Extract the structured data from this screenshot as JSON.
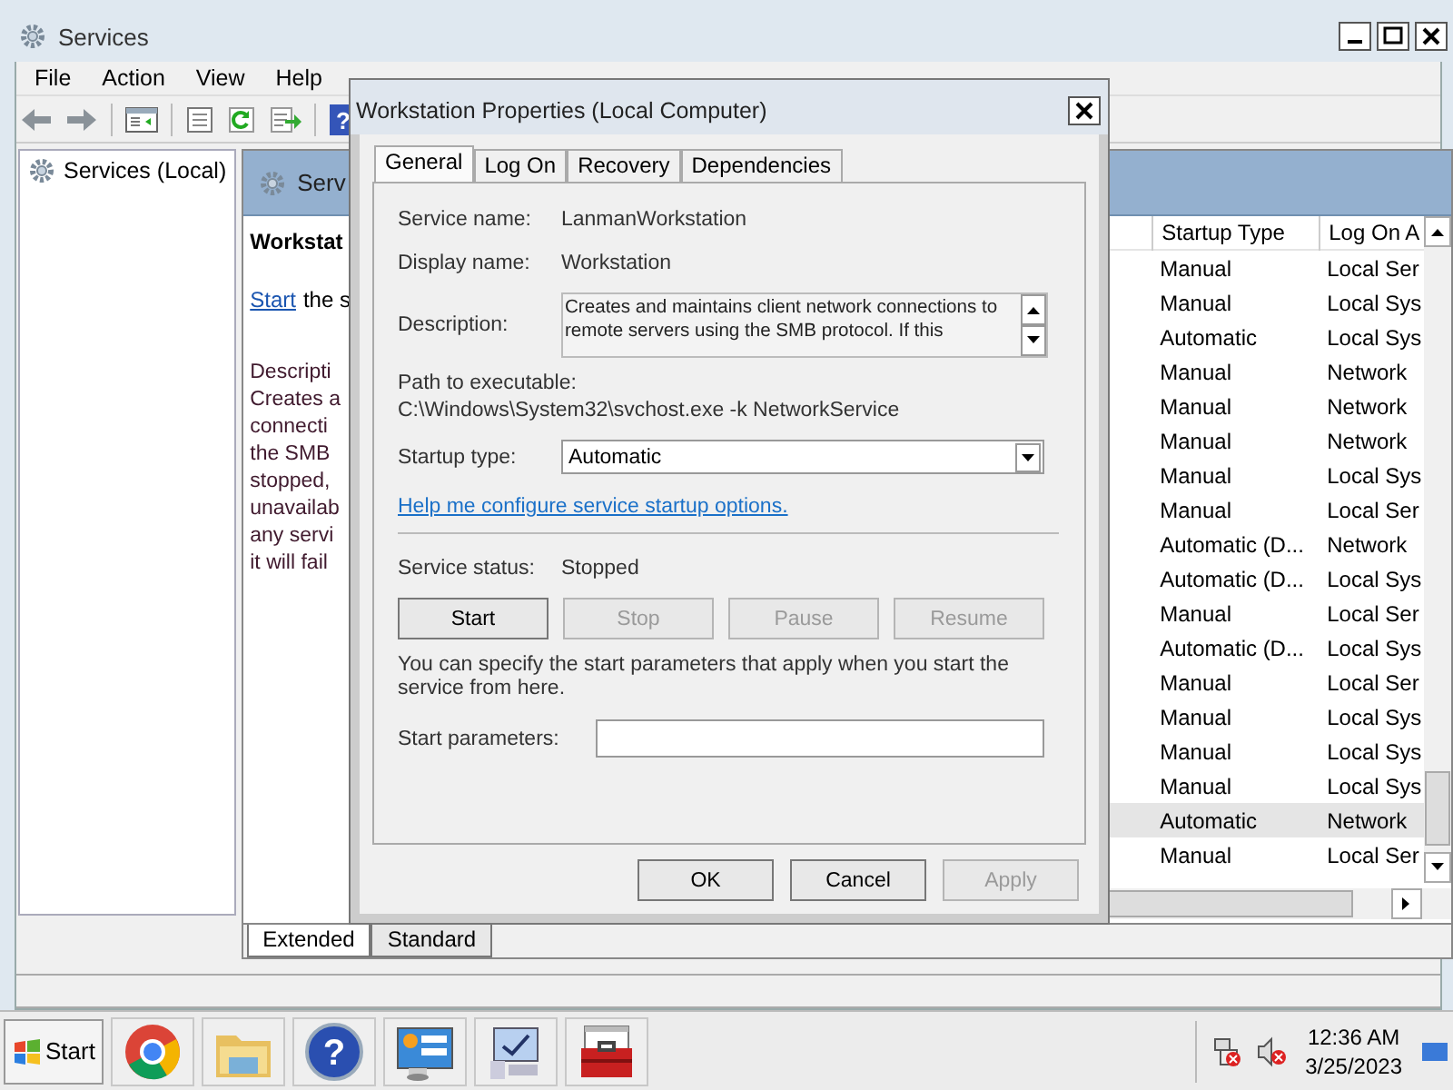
{
  "window": {
    "title": "Services"
  },
  "menu": [
    "File",
    "Action",
    "View",
    "Help"
  ],
  "toolbar": {
    "help_glyph": "?"
  },
  "tree": [
    {
      "label": "Services (Local)",
      "selected": false
    }
  ],
  "detail": {
    "header": "Serv",
    "heading": "Workstat",
    "start_link": "Start",
    "start_rest": "the s",
    "description_lines": [
      "Descripti",
      "Creates a",
      "connecti",
      "the SMB",
      "stopped,",
      "unavailab",
      "any servi",
      "it will fail"
    ]
  },
  "list": {
    "columns": [
      "Startup Type",
      "Log On A"
    ],
    "rows": [
      {
        "startup": "Manual",
        "logon": "Local Ser",
        "selected": false
      },
      {
        "startup": "Manual",
        "logon": "Local Sys",
        "selected": false
      },
      {
        "startup": "Automatic",
        "logon": "Local Sys",
        "selected": false
      },
      {
        "startup": "Manual",
        "logon": "Network",
        "selected": false
      },
      {
        "startup": "Manual",
        "logon": "Network",
        "selected": false
      },
      {
        "startup": "Manual",
        "logon": "Network",
        "selected": false
      },
      {
        "startup": "Manual",
        "logon": "Local Sys",
        "selected": false
      },
      {
        "startup": "Manual",
        "logon": "Local Ser",
        "selected": false
      },
      {
        "startup": "Automatic (D...",
        "logon": "Network",
        "selected": false
      },
      {
        "startup": "Automatic (D...",
        "logon": "Local Sys",
        "selected": false
      },
      {
        "startup": "Manual",
        "logon": "Local Ser",
        "selected": false
      },
      {
        "startup": "Automatic (D...",
        "logon": "Local Sys",
        "selected": false
      },
      {
        "startup": "Manual",
        "logon": "Local Ser",
        "selected": false
      },
      {
        "startup": "Manual",
        "logon": "Local Sys",
        "selected": false
      },
      {
        "startup": "Manual",
        "logon": "Local Sys",
        "selected": false
      },
      {
        "startup": "Manual",
        "logon": "Local Sys",
        "selected": false
      },
      {
        "startup": "Automatic",
        "logon": "Network",
        "selected": true
      },
      {
        "startup": "Manual",
        "logon": "Local Ser",
        "selected": false
      }
    ]
  },
  "view_tabs": [
    {
      "label": "Extended",
      "selected": true
    },
    {
      "label": "Standard",
      "selected": false
    }
  ],
  "dialog": {
    "title": "Workstation Properties (Local Computer)",
    "tabs": [
      {
        "label": "General",
        "selected": true
      },
      {
        "label": "Log On",
        "selected": false
      },
      {
        "label": "Recovery",
        "selected": false
      },
      {
        "label": "Dependencies",
        "selected": false
      }
    ],
    "service_name": {
      "label": "Service name:",
      "value": "LanmanWorkstation"
    },
    "display_name": {
      "label": "Display name:",
      "value": "Workstation"
    },
    "description": {
      "label": "Description:",
      "lines": [
        "Creates and maintains client network connections to",
        "remote servers using the SMB protocol. If this"
      ]
    },
    "path": {
      "label": "Path to executable:",
      "value": "C:\\Windows\\System32\\svchost.exe -k NetworkService"
    },
    "startup_type": {
      "label": "Startup type:",
      "value": "Automatic"
    },
    "help_link": "Help me configure service startup options.",
    "status": {
      "label": "Service status:",
      "value": "Stopped"
    },
    "service_buttons": [
      {
        "label": "Start",
        "disabled": false
      },
      {
        "label": "Stop",
        "disabled": true
      },
      {
        "label": "Pause",
        "disabled": true
      },
      {
        "label": "Resume",
        "disabled": true
      }
    ],
    "params_note": "You can specify the start parameters that apply when you start the service from here.",
    "params_label": "Start parameters:",
    "buttons": [
      {
        "label": "OK",
        "disabled": false
      },
      {
        "label": "Cancel",
        "disabled": false
      },
      {
        "label": "Apply",
        "disabled": true
      }
    ]
  },
  "taskbar": {
    "start": "Start",
    "help_glyph": "?",
    "time": "12:36 AM",
    "date": "3/25/2023"
  }
}
